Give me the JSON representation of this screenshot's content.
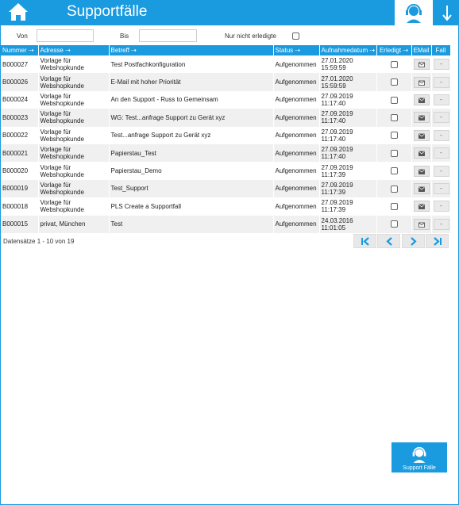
{
  "header": {
    "title": "Supportfälle"
  },
  "filter": {
    "from_label": "Von",
    "from_value": "",
    "to_label": "Bis",
    "to_value": "",
    "open_only_label": "Nur nicht erledigte",
    "open_only_checked": false
  },
  "table": {
    "columns": {
      "number": "Nummer",
      "address": "Adresse",
      "subject": "Betreff",
      "status": "Status",
      "date": "Aufnahmedatum",
      "done": "Erledigt",
      "email": "EMail",
      "case": "Fall"
    },
    "rows": [
      {
        "number": "B000027",
        "address": "Vorlage für Webshopkunde",
        "subject": "Test Postfachkonfiguration",
        "status": "Aufgenommen",
        "date": "27.01.2020 15:59:59",
        "email_icon": "envelope-open",
        "case": "-"
      },
      {
        "number": "B000026",
        "address": "Vorlage für Webshopkunde",
        "subject": "E-Mail mit hoher Priorität",
        "status": "Aufgenommen",
        "date": "27.01.2020 15:59:59",
        "email_icon": "envelope-open",
        "case": "-"
      },
      {
        "number": "B000024",
        "address": "Vorlage für Webshopkunde",
        "subject": "An den Support - Russ to Gemeinsam",
        "status": "Aufgenommen",
        "date": "27.09.2019 11:17:40",
        "email_icon": "envelope",
        "case": "-"
      },
      {
        "number": "B000023",
        "address": "Vorlage für Webshopkunde",
        "subject": "WG: Test...anfrage Support zu Gerät xyz",
        "status": "Aufgenommen",
        "date": "27.09.2019 11:17:40",
        "email_icon": "envelope",
        "case": "-"
      },
      {
        "number": "B000022",
        "address": "Vorlage für Webshopkunde",
        "subject": "Test...anfrage Support zu Gerät xyz",
        "status": "Aufgenommen",
        "date": "27.09.2019 11:17:40",
        "email_icon": "envelope",
        "case": "-"
      },
      {
        "number": "B000021",
        "address": "Vorlage für Webshopkunde",
        "subject": "Papierstau_Test",
        "status": "Aufgenommen",
        "date": "27.09.2019 11:17:40",
        "email_icon": "envelope",
        "case": "-"
      },
      {
        "number": "B000020",
        "address": "Vorlage für Webshopkunde",
        "subject": "Papierstau_Demo",
        "status": "Aufgenommen",
        "date": "27.09.2019 11:17:39",
        "email_icon": "envelope",
        "case": "-"
      },
      {
        "number": "B000019",
        "address": "Vorlage für Webshopkunde",
        "subject": "Test_Support",
        "status": "Aufgenommen",
        "date": "27.09.2019 11:17:39",
        "email_icon": "envelope",
        "case": "-"
      },
      {
        "number": "B000018",
        "address": "Vorlage für Webshopkunde",
        "subject": "PLS Create a Supportfall",
        "status": "Aufgenommen",
        "date": "27.09.2019 11:17:39",
        "email_icon": "envelope",
        "case": "-"
      },
      {
        "number": "B000015",
        "address": "privat, München",
        "subject": "Test",
        "status": "Aufgenommen",
        "date": "24.03.2016 11:01:05",
        "email_icon": "envelope-open",
        "case": "-"
      }
    ]
  },
  "footer": {
    "record_info": "Datensätze 1 - 10 von 19"
  },
  "support_button": {
    "label": "Support Fälle"
  },
  "colors": {
    "accent": "#1a9be0",
    "row_alt": "#f0f0f0"
  },
  "icons": {
    "home": "home-icon",
    "support_headset": "headset-icon",
    "arrow_down": "arrow-down-icon",
    "first": "first-page-icon",
    "prev": "prev-page-icon",
    "next": "next-page-icon",
    "last": "last-page-icon"
  }
}
